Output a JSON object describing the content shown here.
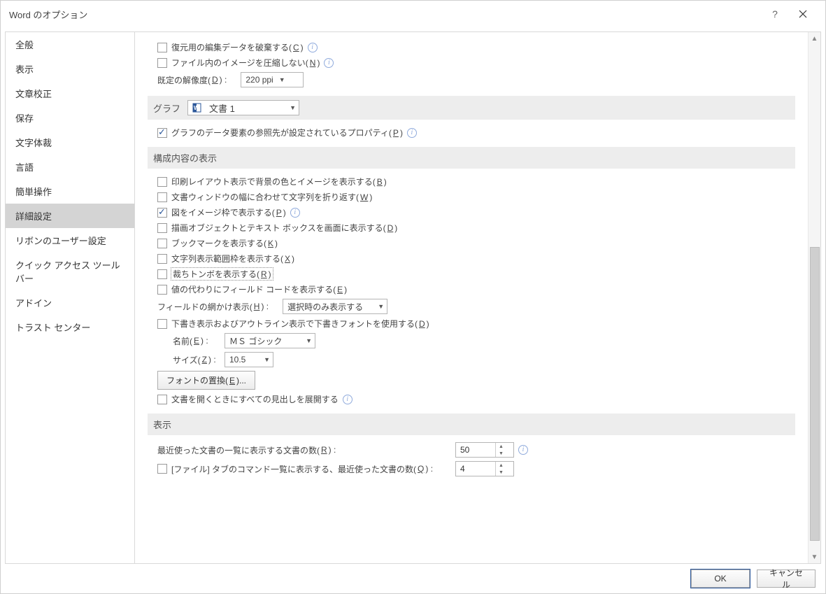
{
  "window": {
    "title": "Word のオプション"
  },
  "sidebar": {
    "items": [
      {
        "label": "全般"
      },
      {
        "label": "表示"
      },
      {
        "label": "文章校正"
      },
      {
        "label": "保存"
      },
      {
        "label": "文字体裁"
      },
      {
        "label": "言語"
      },
      {
        "label": "簡単操作"
      },
      {
        "label": "詳細設定",
        "selected": true
      },
      {
        "label": "リボンのユーザー設定"
      },
      {
        "label": "クイック アクセス ツール バー"
      },
      {
        "label": "アドイン"
      },
      {
        "label": "トラスト センター"
      }
    ]
  },
  "sections": {
    "top": {
      "discard_edit_data": {
        "pre": "復元用の編集データを破棄する(",
        "mn": "C",
        "post": ")"
      },
      "no_compress_images": {
        "pre": "ファイル内のイメージを圧縮しない(",
        "mn": "N",
        "post": ")"
      },
      "default_resolution_label": {
        "pre": "既定の解像度(",
        "mn": "D",
        "post": ") :"
      },
      "default_resolution_value": "220 ppi"
    },
    "chart": {
      "header": "グラフ",
      "doc_dropdown": "文書 1",
      "chart_ref_props": {
        "pre": "グラフのデータ要素の参照先が設定されているプロパティ(",
        "mn": "P",
        "post": ")"
      }
    },
    "show_content": {
      "header": "構成内容の表示",
      "print_layout_bg": {
        "pre": "印刷レイアウト表示で背景の色とイメージを表示する(",
        "mn": "B",
        "post": ")"
      },
      "wrap_to_window": {
        "pre": "文書ウィンドウの幅に合わせて文字列を折り返す(",
        "mn": "W",
        "post": ")"
      },
      "picture_placeholders": {
        "pre": "図をイメージ枠で表示する(",
        "mn": "P",
        "post": ")"
      },
      "drawings_textboxes": {
        "pre": "描画オブジェクトとテキスト ボックスを画面に表示する(",
        "mn": "D",
        "post": ")"
      },
      "bookmarks": {
        "pre": "ブックマークを表示する(",
        "mn": "K",
        "post": ")"
      },
      "text_boundaries": {
        "pre": "文字列表示範囲枠を表示する(",
        "mn": "X",
        "post": ")"
      },
      "crop_marks": {
        "pre": "裁ちトンボを表示する(",
        "mn": "R",
        "post": ")"
      },
      "field_codes": {
        "pre": "値の代わりにフィールド コードを表示する(",
        "mn": "E",
        "post": ")"
      },
      "field_shading_label": {
        "pre": "フィールドの網かけ表示(",
        "mn": "H",
        "post": ") :"
      },
      "field_shading_value": "選択時のみ表示する",
      "draft_font": {
        "pre": "下書き表示およびアウトライン表示で下書きフォントを使用する(",
        "mn": "D",
        "post": ")"
      },
      "font_name_label": {
        "pre": "名前(",
        "mn": "E",
        "post": ") :"
      },
      "font_name_value": "ＭＳ ゴシック",
      "font_size_label": {
        "pre": "サイズ(",
        "mn": "Z",
        "post": ") :"
      },
      "font_size_value": "10.5",
      "font_substitution": {
        "pre": "フォントの置換(",
        "mn": "E",
        "post": ")..."
      },
      "expand_headings": "文書を開くときにすべての見出しを展開する"
    },
    "display": {
      "header": "表示",
      "recent_docs_label": {
        "pre": "最近使った文書の一覧に表示する文書の数(",
        "mn": "R",
        "post": ") :"
      },
      "recent_docs_value": "50",
      "quick_access_recent_label": {
        "pre": "[ファイル] タブのコマンド一覧に表示する、最近使った文書の数(",
        "mn": "Q",
        "post": ") :"
      },
      "quick_access_recent_value": "4"
    }
  },
  "footer": {
    "ok": "OK",
    "cancel": "キャンセル"
  }
}
